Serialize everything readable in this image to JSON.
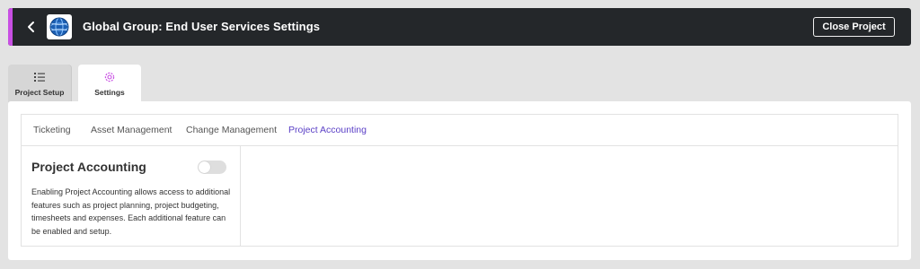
{
  "header": {
    "title": "Global Group: End User Services Settings",
    "close_label": "Close Project",
    "accent_color": "#c84fe3",
    "bg_color": "#24272a",
    "back_icon": "chevron-left-icon",
    "logo": "globe-logo"
  },
  "tabs": [
    {
      "label": "Project Setup",
      "icon": "checklist-icon",
      "active": false
    },
    {
      "label": "Settings",
      "icon": "gear-icon",
      "active": true
    }
  ],
  "subtabs": [
    {
      "label": "Ticketing",
      "active": false
    },
    {
      "label": "Asset Management",
      "active": false
    },
    {
      "label": "Change Management",
      "active": false
    },
    {
      "label": "Project Accounting",
      "active": true
    }
  ],
  "panel": {
    "title": "Project Accounting",
    "toggle_on": false,
    "description": "Enabling Project Accounting allows access to additional features such as project planning, project budgeting, timesheets and expenses. Each additional feature can be enabled and setup."
  },
  "colors": {
    "active_subtab": "#5a3fc6",
    "settings_icon": "#c84fe3"
  }
}
